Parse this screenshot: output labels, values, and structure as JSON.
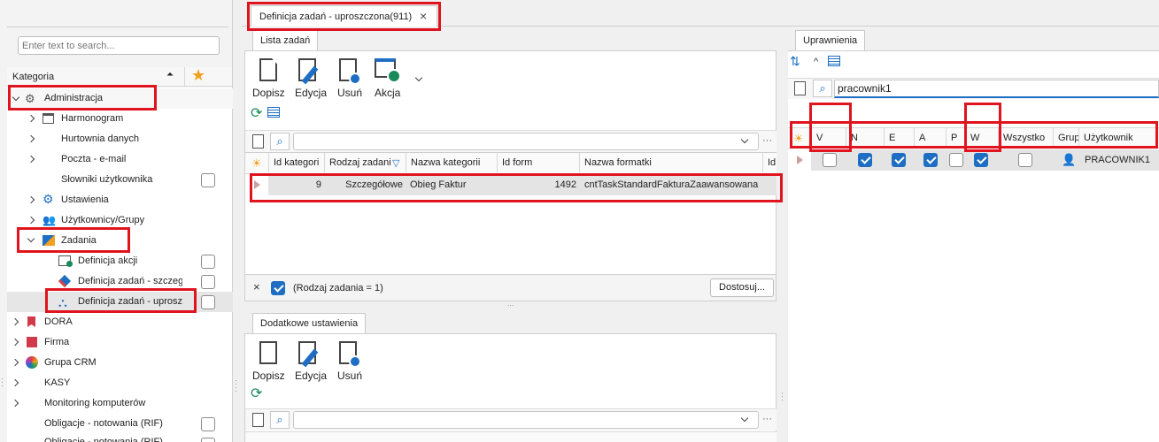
{
  "sidebar": {
    "search_placeholder": "Enter text to search...",
    "column_header": "Kategoria",
    "items": [
      {
        "label": "Administracja"
      },
      {
        "label": "Harmonogram"
      },
      {
        "label": "Hurtownia danych"
      },
      {
        "label": "Poczta - e-mail"
      },
      {
        "label": "Słowniki użytkownika"
      },
      {
        "label": "Ustawienia"
      },
      {
        "label": "Użytkownicy/Grupy"
      },
      {
        "label": "Zadania"
      },
      {
        "label": "Definicja akcji"
      },
      {
        "label": "Definicja zadań - szczegó"
      },
      {
        "label": "Definicja zadań - uproszc"
      },
      {
        "label": "DORA"
      },
      {
        "label": "Firma"
      },
      {
        "label": "Grupa CRM"
      },
      {
        "label": "KASY"
      },
      {
        "label": "Monitoring komputerów"
      },
      {
        "label": "Obligacje - notowania (RIF)"
      },
      {
        "label": "Obligacje - notowania (RIF)"
      }
    ]
  },
  "doc_tab": {
    "label": "Definicja zadań - uproszczona(911)",
    "close": "×"
  },
  "lista": {
    "tab": "Lista zadań",
    "toolbar": {
      "add": "Dopisz",
      "edit": "Edycja",
      "delete": "Usuń",
      "action": "Akcja"
    },
    "columns": [
      "Id kategori",
      "Rodzaj zadani",
      "Nazwa kategorii",
      "Id form",
      "Nazwa formatki",
      "Id"
    ],
    "rows": [
      {
        "id_kategorii": "9",
        "rodzaj": "Szczegółowe",
        "nazwa_kategorii": "Obieg Faktur",
        "id_form": "1492",
        "nazwa_formatki": "cntTaskStandardFakturaZaawansowana"
      }
    ],
    "filter_text": "(Rodzaj zadania = 1)",
    "customize_button": "Dostosuj..."
  },
  "dodatkowe": {
    "tab": "Dodatkowe ustawienia",
    "toolbar": {
      "add": "Dopisz",
      "edit": "Edycja",
      "delete": "Usuń"
    }
  },
  "uprawnienia": {
    "tab": "Uprawnienia",
    "caret": "^",
    "search_value": "pracownik1",
    "columns": [
      "V",
      "N",
      "E",
      "A",
      "P",
      "W",
      "Wszystko",
      "Grup",
      "Użytkownik"
    ],
    "row": {
      "user": "PRACOWNIK1",
      "V": false,
      "N": true,
      "E": true,
      "A": true,
      "P": false,
      "W": true,
      "Wszystko": false
    }
  }
}
